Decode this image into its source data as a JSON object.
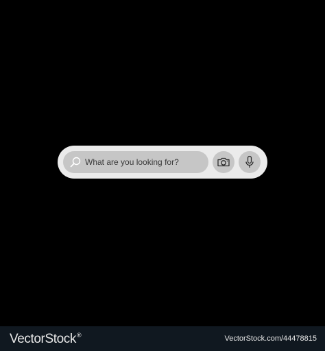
{
  "search": {
    "placeholder": "What are you looking for?",
    "value": ""
  },
  "icons": {
    "search": "search-icon",
    "camera": "camera-icon",
    "microphone": "microphone-icon"
  },
  "footer": {
    "brand": "VectorStock",
    "brand_mark": "®",
    "image_ref": "VectorStock.com/44478815"
  },
  "colors": {
    "background": "#000000",
    "bar": "#ebebeb",
    "field": "#c6c6c6",
    "footer": "#101820"
  }
}
